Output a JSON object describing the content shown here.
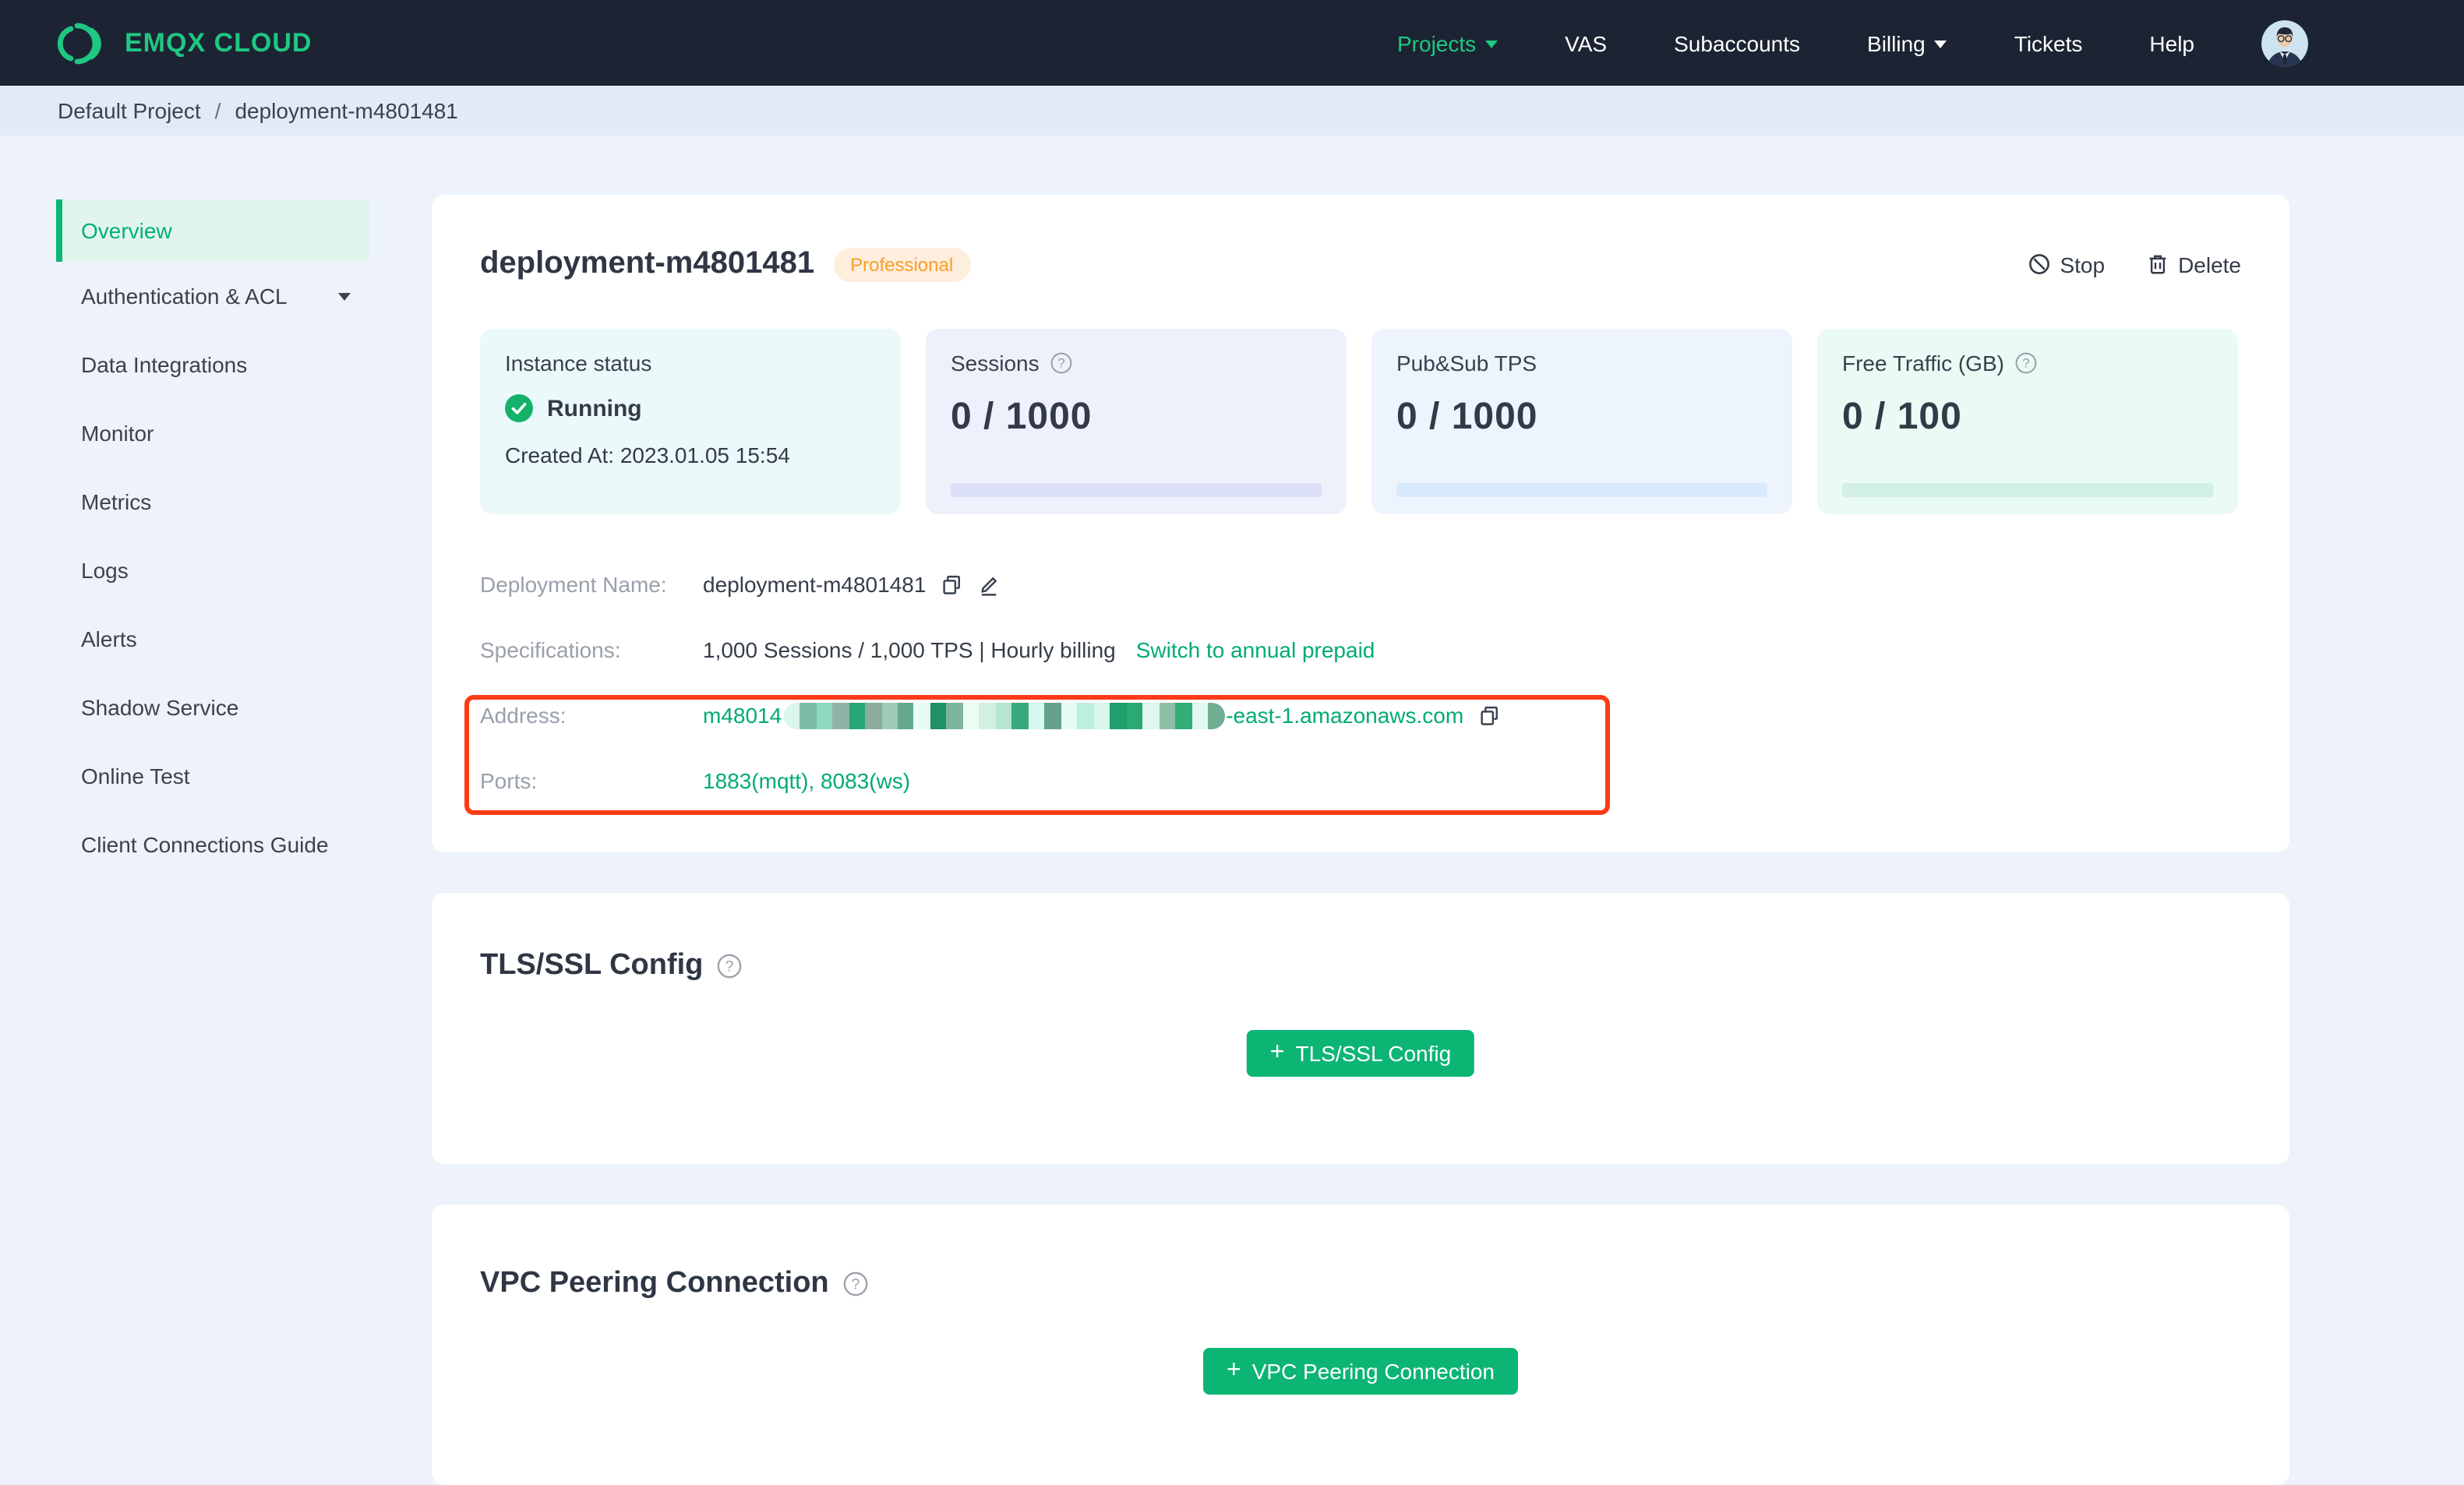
{
  "topbar": {
    "logo_text": "EMQX CLOUD",
    "nav": [
      {
        "label": "Projects"
      },
      {
        "label": "VAS"
      },
      {
        "label": "Subaccounts"
      },
      {
        "label": "Billing"
      },
      {
        "label": "Tickets"
      },
      {
        "label": "Help"
      }
    ]
  },
  "breadcrumb": {
    "project": "Default Project",
    "separator": "/",
    "current": "deployment-m4801481"
  },
  "sidebar": {
    "items": [
      {
        "label": "Overview"
      },
      {
        "label": "Authentication & ACL"
      },
      {
        "label": "Data Integrations"
      },
      {
        "label": "Monitor"
      },
      {
        "label": "Metrics"
      },
      {
        "label": "Logs"
      },
      {
        "label": "Alerts"
      },
      {
        "label": "Shadow Service"
      },
      {
        "label": "Online Test"
      },
      {
        "label": "Client Connections Guide"
      }
    ]
  },
  "deployment": {
    "title": "deployment-m4801481",
    "plan_badge": "Professional",
    "actions": {
      "stop": "Stop",
      "delete": "Delete"
    },
    "stats": {
      "instance": {
        "label": "Instance status",
        "status": "Running",
        "created": "Created At: 2023.01.05 15:54"
      },
      "sessions": {
        "label": "Sessions",
        "value": "0 / 1000"
      },
      "tps": {
        "label": "Pub&Sub TPS",
        "value": "0 / 1000"
      },
      "traffic": {
        "label": "Free Traffic (GB)",
        "value": "0 / 100"
      }
    },
    "info": {
      "name_label": "Deployment Name:",
      "name_value": "deployment-m4801481",
      "spec_label": "Specifications:",
      "spec_value": "1,000 Sessions / 1,000 TPS | Hourly billing",
      "spec_link": "Switch to annual prepaid",
      "address_label": "Address:",
      "address_prefix": "m48014",
      "address_suffix": "-east-1.amazonaws.com",
      "ports_label": "Ports:",
      "ports_value": "1883(mqtt), 8083(ws)"
    },
    "redaction_colors": [
      "#d9f7ef",
      "#7bbda8",
      "#8fd9c0",
      "#8fb3a6",
      "#27a877",
      "#8aab9e",
      "#9ecbb8",
      "#63a88d",
      "#e8fbf5",
      "#1f9165",
      "#7db59f",
      "#ebfcf2",
      "#d3efe2",
      "#b5e6d2",
      "#3aaa7d",
      "#d8f9ef",
      "#68a18b",
      "#e6fbf4",
      "#baf0dc",
      "#d9f6ec",
      "#1f9f6d",
      "#2ba873",
      "#dff7ee",
      "#8fbfa9",
      "#2fae78",
      "#e2f8f0",
      "#6fae93"
    ]
  },
  "sections": {
    "tls": {
      "title": "TLS/SSL Config",
      "button": "TLS/SSL Config"
    },
    "vpc": {
      "title": "VPC Peering Connection",
      "button": "VPC Peering Connection"
    }
  },
  "colors": {
    "accent_green": "#00b173",
    "button_green": "#0db574",
    "logo_green": "#1ec883",
    "badge_orange": "#f99e2c",
    "badge_bg": "#fdeedd",
    "annotation_red": "#fb3b17",
    "status_green": "#13b26b",
    "topbar_bg": "#1c2433"
  }
}
